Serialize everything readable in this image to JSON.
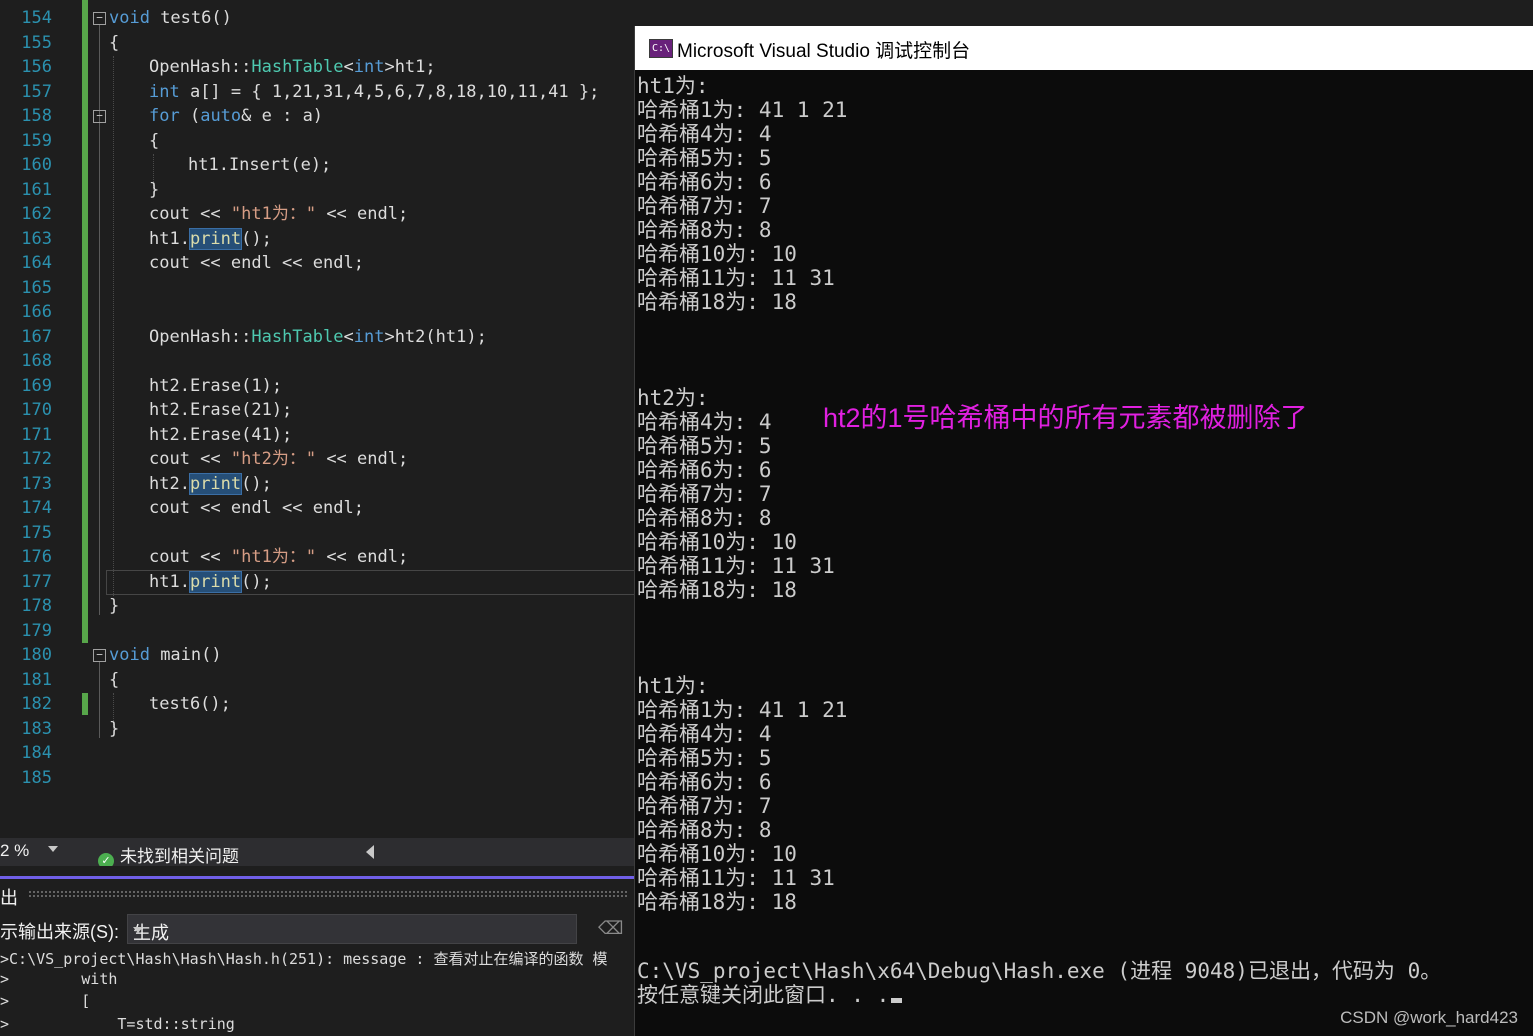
{
  "editor": {
    "line_numbers": [
      "154",
      "155",
      "156",
      "157",
      "158",
      "159",
      "160",
      "161",
      "162",
      "163",
      "164",
      "165",
      "166",
      "167",
      "168",
      "169",
      "170",
      "171",
      "172",
      "173",
      "174",
      "175",
      "176",
      "177",
      "178",
      "179",
      "180",
      "181",
      "182",
      "183",
      "184",
      "185"
    ],
    "code": {
      "l154": [
        "void",
        " test6()"
      ],
      "l155": [
        "{"
      ],
      "l156": [
        "OpenHash::",
        "HashTable",
        "<",
        "int",
        ">ht1;"
      ],
      "l157": [
        "int",
        " a[] = { 1,21,31,4,5,6,7,8,18,10,11,41 };"
      ],
      "l158": [
        "for",
        " (",
        "auto",
        "& e : a)"
      ],
      "l159": [
        "{"
      ],
      "l160": [
        "ht1.Insert(e);"
      ],
      "l161": [
        "}"
      ],
      "l162": [
        "cout << ",
        "\"ht1为：\"",
        " << endl;"
      ],
      "l163": [
        "ht1.",
        "print",
        "();"
      ],
      "l164": [
        "cout << endl << endl;"
      ],
      "l167": [
        "OpenHash::",
        "HashTable",
        "<",
        "int",
        ">ht2(ht1);"
      ],
      "l169": [
        "ht2.Erase(1);"
      ],
      "l170": [
        "ht2.Erase(21);"
      ],
      "l171": [
        "ht2.Erase(41);"
      ],
      "l172": [
        "cout << ",
        "\"ht2为：\"",
        " << endl;"
      ],
      "l173": [
        "ht2.",
        "print",
        "();"
      ],
      "l174": [
        "cout << endl << endl;"
      ],
      "l176": [
        "cout << ",
        "\"ht1为：\"",
        " << endl;"
      ],
      "l177": [
        "ht1.",
        "print",
        "();"
      ],
      "l178": [
        "}"
      ],
      "l180": [
        "void",
        " main()"
      ],
      "l181": [
        "{"
      ],
      "l182": [
        "test6();"
      ],
      "l183": [
        "}"
      ]
    }
  },
  "status_bar": {
    "zoom": "2 %",
    "issues": "未找到相关问题"
  },
  "output_pane": {
    "title": "出",
    "source_label": "示输出来源(S):",
    "source_value": "生成",
    "lines": [
      ">C:\\VS_project\\Hash\\Hash\\Hash.h(251): message : 查看对止在编译的函数 模",
      ">        with",
      ">        [",
      ">            T=std::string"
    ]
  },
  "console": {
    "title": "Microsoft Visual Studio 调试控制台",
    "icon_text": "C:\\",
    "lines": [
      "ht1为:",
      "哈希桶1为: 41 1 21",
      "哈希桶4为: 4",
      "哈希桶5为: 5",
      "哈希桶6为: 6",
      "哈希桶7为: 7",
      "哈希桶8为: 8",
      "哈希桶10为: 10",
      "哈希桶11为: 11 31",
      "哈希桶18为: 18",
      "",
      "",
      "",
      "ht2为:",
      "哈希桶4为: 4",
      "哈希桶5为: 5",
      "哈希桶6为: 6",
      "哈希桶7为: 7",
      "哈希桶8为: 8",
      "哈希桶10为: 10",
      "哈希桶11为: 11 31",
      "哈希桶18为: 18",
      "",
      "",
      "",
      "ht1为:",
      "哈希桶1为: 41 1 21",
      "哈希桶4为: 4",
      "哈希桶5为: 5",
      "哈希桶6为: 6",
      "哈希桶7为: 7",
      "哈希桶8为: 8",
      "哈希桶10为: 10",
      "哈希桶11为: 11 31",
      "哈希桶18为: 18",
      "",
      "",
      "C:\\VS_project\\Hash\\x64\\Debug\\Hash.exe (进程 9048)已退出，代码为 0。",
      "按任意键关闭此窗口. . ."
    ],
    "annotation": "ht2的1号哈希桶中的所有元素都被删除了",
    "watermark": "CSDN @work_hard423"
  },
  "colors": {
    "keyword": "#569cd6",
    "type": "#4ec9b0",
    "string": "#d69d85",
    "line_number": "#2b91af",
    "annotation": "#e020e0",
    "changebar": "#57a64a"
  }
}
